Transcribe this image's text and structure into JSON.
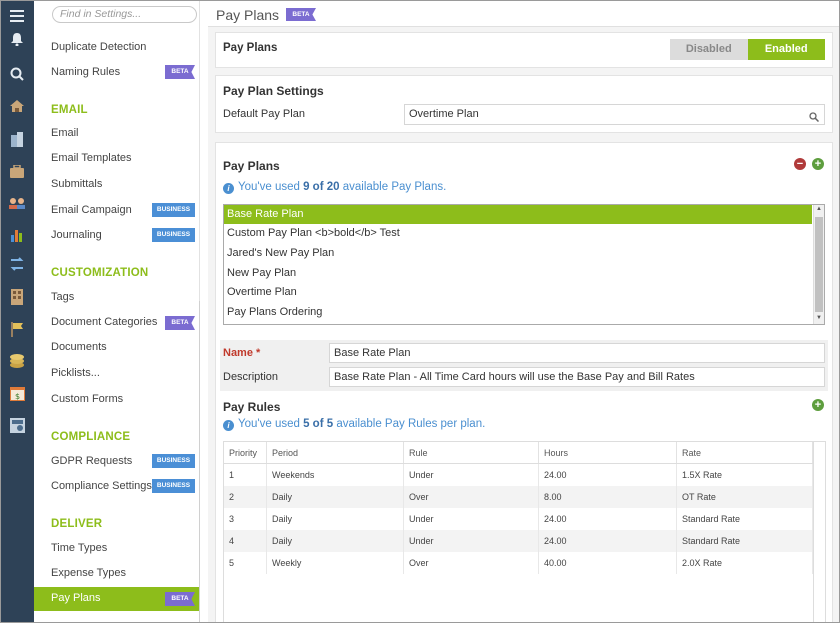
{
  "sidebar": {
    "search_placeholder": "Find in Settings...",
    "items": [
      {
        "label": "Duplicate Detection"
      },
      {
        "label": "Naming Rules",
        "badge": "BETA"
      }
    ],
    "sections": [
      {
        "title": "EMAIL",
        "items": [
          {
            "label": "Email"
          },
          {
            "label": "Email Templates"
          },
          {
            "label": "Submittals"
          },
          {
            "label": "Email Campaign",
            "badge": "BUSINESS"
          },
          {
            "label": "Journaling",
            "badge": "BUSINESS"
          }
        ]
      },
      {
        "title": "CUSTOMIZATION",
        "items": [
          {
            "label": "Tags"
          },
          {
            "label": "Document Categories",
            "badge": "BETA"
          },
          {
            "label": "Documents"
          },
          {
            "label": "Picklists..."
          },
          {
            "label": "Custom Forms"
          }
        ]
      },
      {
        "title": "COMPLIANCE",
        "items": [
          {
            "label": "GDPR Requests",
            "badge": "BUSINESS"
          },
          {
            "label": "Compliance Settings",
            "badge": "BUSINESS"
          }
        ]
      },
      {
        "title": "DELIVER",
        "items": [
          {
            "label": "Time Types"
          },
          {
            "label": "Expense Types"
          },
          {
            "label": "Pay Plans",
            "badge": "BETA"
          }
        ]
      }
    ]
  },
  "header": {
    "title": "Pay Plans",
    "badge": "BETA"
  },
  "feature": {
    "label": "Pay Plans",
    "disabled_label": "Disabled",
    "enabled_label": "Enabled",
    "state": "Enabled"
  },
  "settings": {
    "heading": "Pay Plan Settings",
    "default_label": "Default Pay Plan",
    "default_value": "Overtime Plan"
  },
  "plans": {
    "heading": "Pay Plans",
    "usage_prefix": "You've used",
    "usage_count": "9 of 20",
    "usage_suffix": "available Pay Plans.",
    "items": [
      "Base Rate Plan",
      "Custom Pay Plan <b>bold</b> Test",
      "Jared's New Pay Plan",
      "New Pay Plan",
      "Overtime Plan",
      "Pay Plans Ordering"
    ],
    "selected": "Base Rate Plan"
  },
  "detail": {
    "name_label": "Name",
    "required_mark": "*",
    "name_value": "Base Rate Plan",
    "description_label": "Description",
    "description_value": "Base Rate Plan - All Time Card hours will use the Base Pay and Bill Rates"
  },
  "rules": {
    "heading": "Pay Rules",
    "usage_prefix": "You've used",
    "usage_count": "5 of 5",
    "usage_suffix": "available Pay Rules per plan.",
    "columns": [
      "Priority",
      "Period",
      "Rule",
      "Hours",
      "Rate"
    ],
    "rows": [
      [
        "1",
        "Weekends",
        "Under",
        "24.00",
        "1.5X Rate"
      ],
      [
        "2",
        "Daily",
        "Over",
        "8.00",
        "OT Rate"
      ],
      [
        "3",
        "Daily",
        "Under",
        "24.00",
        "Standard Rate"
      ],
      [
        "4",
        "Daily",
        "Under",
        "24.00",
        "Standard Rate"
      ],
      [
        "5",
        "Weekly",
        "Over",
        "40.00",
        "2.0X Rate"
      ]
    ]
  },
  "colors": {
    "accent": "#8dbd1b",
    "rail": "#2e4257",
    "beta": "#7b6cd1",
    "business": "#4b8fd6",
    "info": "#4a8fd0"
  }
}
